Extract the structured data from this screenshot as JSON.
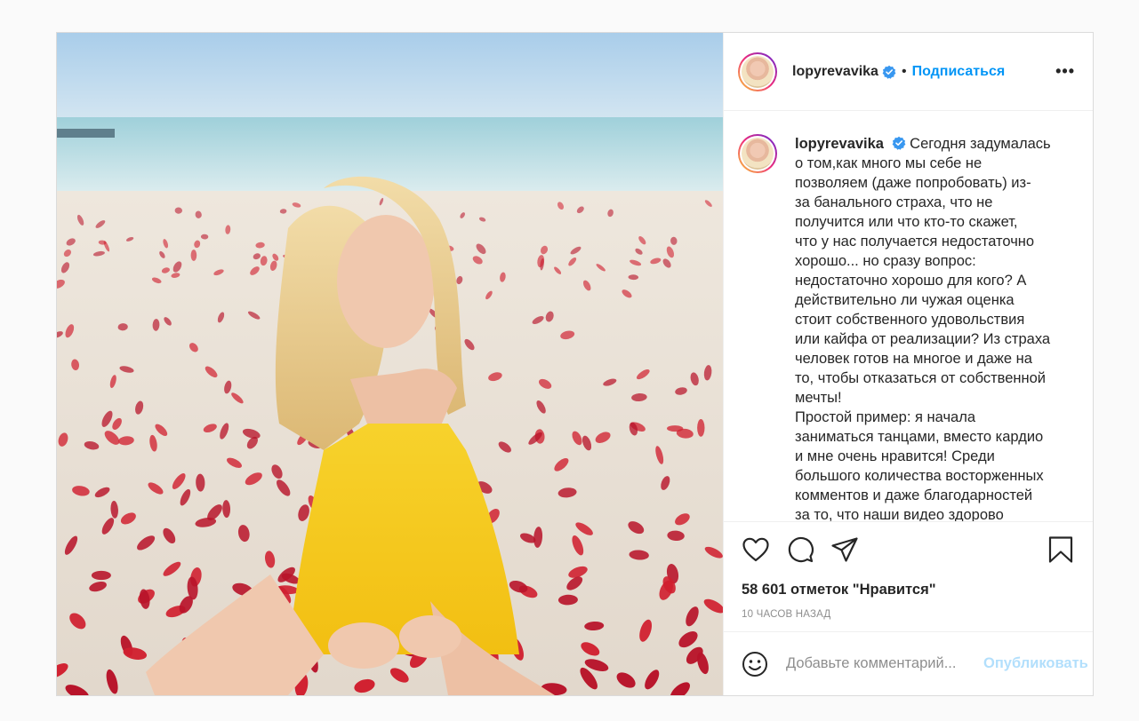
{
  "post": {
    "username": "lopyrevavika",
    "follow_label": "Подписаться",
    "more_label": "•••",
    "separator": "•",
    "caption_lines": [
      "Сегодня задумалась",
      "о том,как много мы себе не",
      "позволяем (даже попробовать) из-",
      "за банального страха, что не",
      "получится или что кто-то скажет,",
      "что у нас получается недостаточно",
      "хорошо... но сразу вопрос:",
      "недостаточно хорошо для кого? А",
      "действительно ли чужая оценка",
      "стоит собственного удовольствия",
      "или кайфа от реализации? Из страха",
      "человек готов на многое и даже на",
      "то, чтобы отказаться от собственной",
      "мечты!",
      "Простой пример: я начала",
      "заниматься танцами, вместо кардио",
      "и мне очень нравится! Среди",
      "большого количества восторженных",
      "комментов и даже благодарностей",
      "за то, что наши видео здорово"
    ],
    "likes_text": "58 601 отметок \"Нравится\"",
    "time_text": "10 ЧАСОВ НАЗАД",
    "comment_placeholder": "Добавьте комментарий...",
    "publish_label": "Опубликовать"
  },
  "icons": {
    "verified": "verified-badge-icon",
    "like": "heart-icon",
    "comment": "comment-bubble-icon",
    "share": "paper-plane-icon",
    "save": "bookmark-icon",
    "emoji": "smiley-icon"
  },
  "colors": {
    "accent": "#0095f6",
    "publish_disabled": "#b2dffc",
    "muted": "#8e8e8e",
    "text": "#262626",
    "border": "#dbdbdb"
  }
}
